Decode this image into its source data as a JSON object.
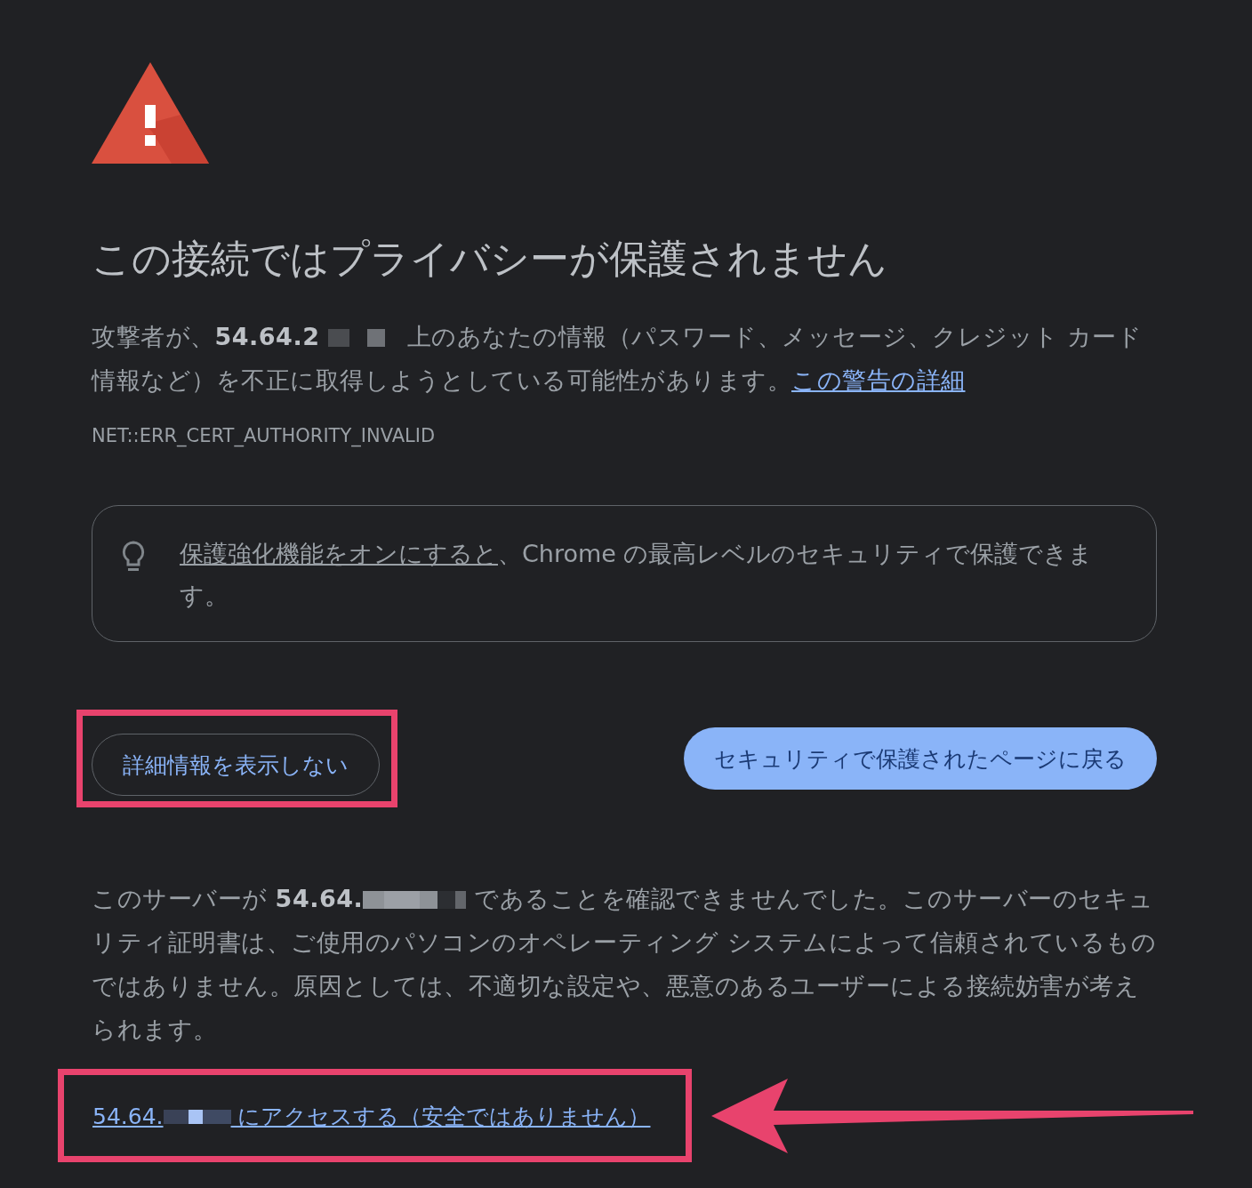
{
  "warning": {
    "title": "この接続ではプライバシーが保護されません",
    "message": {
      "before": "攻撃者が、**54.64.2**",
      "after": "上のあなたの情報（パスワード、メッセージ、クレジット カード情報など）を不正に取得しようとしている可能性があります。",
      "link": "この警告の詳細"
    },
    "error_code": "NET::ERR_CERT_AUTHORITY_INVALID"
  },
  "enhanced_protection": {
    "link": "保護強化機能をオンにすると",
    "text": "、Chrome の最高レベルのセキュリティで保護できます。"
  },
  "buttons": [
    {
      "label": "詳細情報を表示しない",
      "kind": "secondary",
      "highlighted": true
    },
    {
      "label": "セキュリティで保護されたページに戻る",
      "kind": "primary",
      "highlighted": false
    }
  ],
  "details": {
    "before": "このサーバーが **54.64.**",
    "after": "であることを確認できませんでした。このサーバーのセキュリティ証明書は、ご使用のパソコンのオペレーティング システムによって信頼されているものではありません。原因としては、不適切な設定や、悪意のあるユーザーによる接続妨害が考えられます。",
    "proceed_link": {
      "before": "54.64.",
      "after": "にアクセスする（安全ではありません）",
      "highlighted": true
    }
  }
}
